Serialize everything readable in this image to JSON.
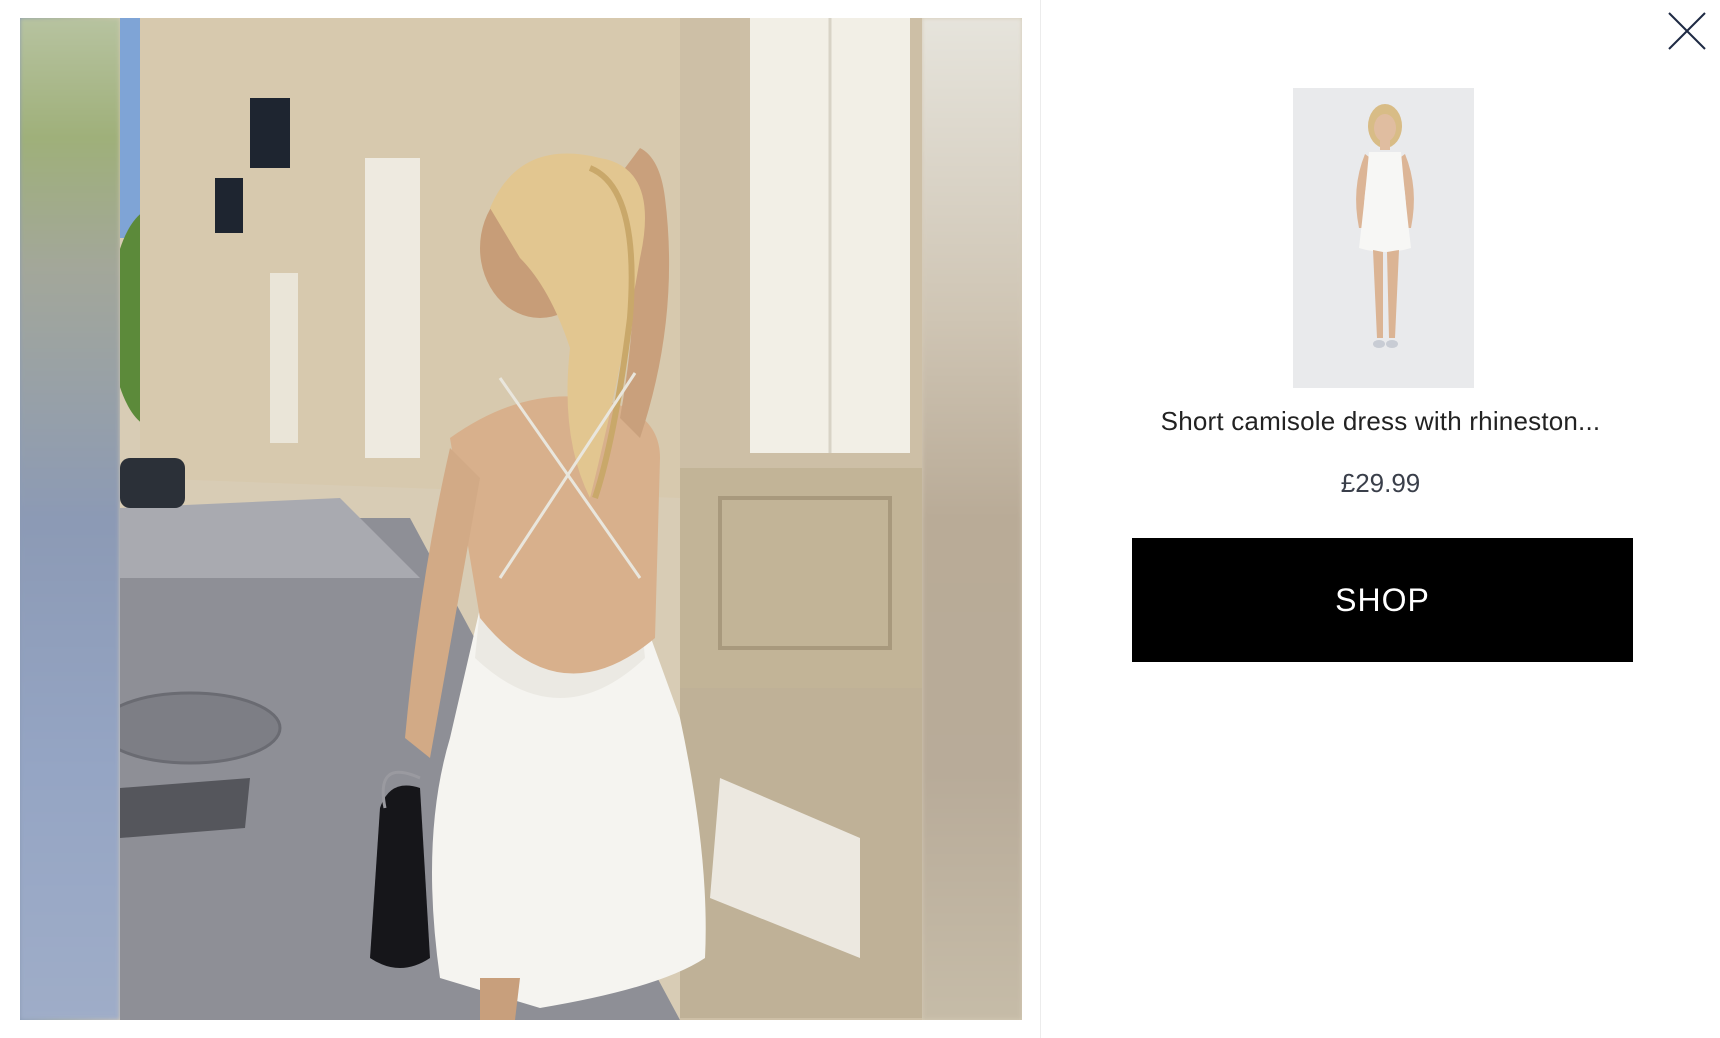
{
  "modal": {
    "close_icon": "close-icon"
  },
  "media": {
    "image_subject": "woman-in-white-backless-dress-photo"
  },
  "product": {
    "title": "Short camisole dress with rhineston...",
    "price": "£29.99",
    "shop_label": "SHOP",
    "thumbnail": "product-thumbnail-image"
  },
  "colors": {
    "button_bg": "#000000",
    "button_text": "#ffffff",
    "title_text": "#222222",
    "price_text": "#3a3f4a"
  }
}
